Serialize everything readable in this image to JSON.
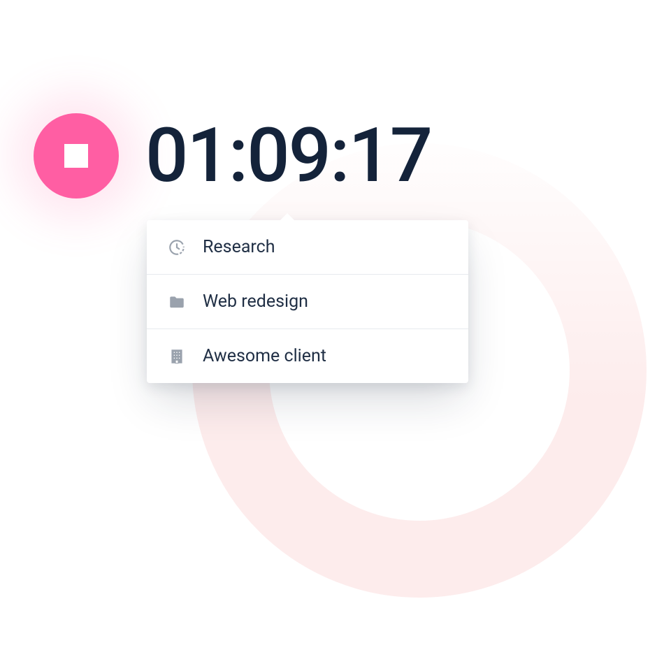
{
  "timer": {
    "elapsed": "01:09:17"
  },
  "dropdown": {
    "items": [
      {
        "icon": "clock-icon",
        "label": "Research"
      },
      {
        "icon": "folder-icon",
        "label": "Web redesign"
      },
      {
        "icon": "building-icon",
        "label": "Awesome client"
      }
    ]
  },
  "colors": {
    "accent": "#FF5EA3",
    "ring": "#FDECEC",
    "text_dark": "#14233A",
    "icon_gray": "#9AA2AD"
  }
}
